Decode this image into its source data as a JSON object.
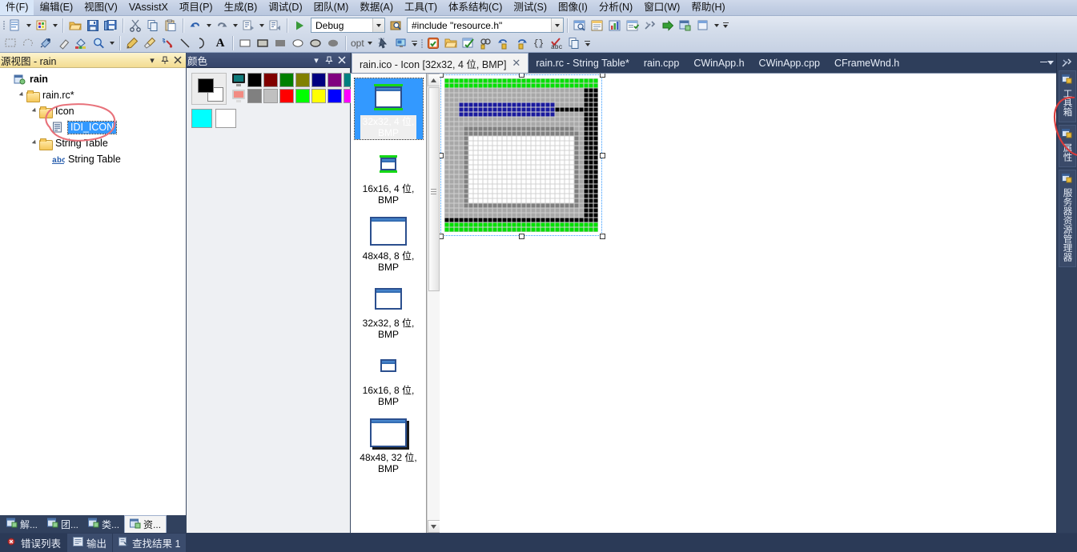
{
  "menu": {
    "items": [
      "件(F)",
      "编辑(E)",
      "视图(V)",
      "VAssistX",
      "项目(P)",
      "生成(B)",
      "调试(D)",
      "团队(M)",
      "数据(A)",
      "工具(T)",
      "体系结构(C)",
      "测试(S)",
      "图像(I)",
      "分析(N)",
      "窗口(W)",
      "帮助(H)"
    ]
  },
  "toolbar": {
    "config_value": "Debug",
    "find_value": "#include \"resource.h\"",
    "opt_label": "opt",
    "icons_row1": [
      "new-item-icon",
      "add-item-icon",
      "open-folder-icon",
      "save-icon",
      "save-all-icon",
      "cut-icon",
      "copy-icon",
      "paste-icon",
      "undo-icon",
      "redo-icon",
      "comment-icon",
      "uncomment-icon",
      "start-debug-icon",
      "find-in-files-icon"
    ],
    "icons_row2": [
      "rect-select-icon",
      "lasso-select-icon",
      "eyedropper-icon",
      "eraser-icon",
      "fill-icon",
      "magnifier-icon",
      "pencil-icon",
      "brush-icon",
      "airbrush-icon",
      "line-icon",
      "curve-icon",
      "text-icon",
      "rect-outline-icon",
      "rect-filled-icon",
      "rect-solid-icon",
      "ellipse-outline-icon",
      "ellipse-filled-icon",
      "ellipse-solid-icon",
      "opt-dropdown",
      "select-cursor-icon",
      "monitor-icon"
    ],
    "icons_right1": [
      "toolbox-icon",
      "properties-window-icon",
      "object-browser-icon",
      "task-list-icon",
      "tools-icon",
      "go-to-icon",
      "class-view-icon",
      "new-window-icon"
    ],
    "icons_right2": [
      "find-symbol-icon",
      "undo-nav-icon",
      "redo-nav-icon",
      "braces-icon",
      "spell-check-icon",
      "copy-doc-icon"
    ]
  },
  "resource_view": {
    "title": "源视图 - rain",
    "dropdown_icon": "chevron-down-icon",
    "pin_icon": "pin-icon",
    "close_icon": "close-icon",
    "tree": [
      {
        "label": "rain",
        "icon": "solution-icon",
        "indent": 0,
        "bold": true,
        "expander": "none"
      },
      {
        "label": "rain.rc*",
        "icon": "folder-icon",
        "indent": 1,
        "bold": false,
        "expander": "open"
      },
      {
        "label": "Icon",
        "icon": "folder-icon",
        "indent": 2,
        "bold": false,
        "expander": "open"
      },
      {
        "label": "IDI_ICON",
        "icon": "resource-icon",
        "indent": 3,
        "bold": false,
        "expander": "none",
        "selected": true
      },
      {
        "label": "String Table",
        "icon": "folder-icon",
        "indent": 2,
        "bold": false,
        "expander": "open"
      },
      {
        "label": "String Table",
        "icon": "abc-icon",
        "indent": 3,
        "bold": false,
        "expander": "none"
      }
    ],
    "bottom_tabs": [
      {
        "label": "解...",
        "icon": "solution-explorer-icon",
        "active": false
      },
      {
        "label": "团...",
        "icon": "team-explorer-icon",
        "active": false
      },
      {
        "label": "类...",
        "icon": "class-view-icon",
        "active": false
      },
      {
        "label": "资...",
        "icon": "resource-view-icon",
        "active": true
      }
    ]
  },
  "colors_panel": {
    "title": "颜色",
    "dropdown_icon": "chevron-down-icon",
    "pin_icon": "pin-icon",
    "close_icon": "close-icon",
    "foreground": "#000000",
    "background": "#ffffff",
    "swatch_row1": [
      "screen",
      "#000000",
      "#800000",
      "#008000",
      "#808000",
      "#000080",
      "#800080",
      "#008080"
    ],
    "swatch_row2": [
      "screen-inverse",
      "#808080",
      "#c0c0c0",
      "#ff0000",
      "#00ff00",
      "#ffff00",
      "#0000ff",
      "#ff00ff"
    ],
    "swatch_row3": [
      "#00ffff",
      "#ffffff"
    ]
  },
  "tabs": [
    {
      "label": "rain.ico - Icon [32x32, 4 位, BMP]",
      "active": true,
      "closable": true
    },
    {
      "label": "rain.rc - String Table*",
      "active": false,
      "closable": false
    },
    {
      "label": "rain.cpp",
      "active": false,
      "closable": false
    },
    {
      "label": "CWinApp.h",
      "active": false,
      "closable": false
    },
    {
      "label": "CWinApp.cpp",
      "active": false,
      "closable": false
    },
    {
      "label": "CFrameWnd.h",
      "active": false,
      "closable": false
    }
  ],
  "icon_list": [
    {
      "label": "32x32, 4 位,\nBMP",
      "size": 34,
      "selected": true,
      "style": "green"
    },
    {
      "label": "16x16, 4 位,\nBMP",
      "size": 20,
      "selected": false,
      "style": "green"
    },
    {
      "label": "48x48, 8 位,\nBMP",
      "size": 46,
      "selected": false,
      "style": "plain"
    },
    {
      "label": "32x32, 8 位,\nBMP",
      "size": 34,
      "selected": false,
      "style": "plain"
    },
    {
      "label": "16x16, 8 位,\nBMP",
      "size": 20,
      "selected": false,
      "style": "plain"
    },
    {
      "label": "48x48, 32 位,\nBMP",
      "size": 46,
      "selected": false,
      "style": "shadow"
    }
  ],
  "canvas": {
    "cell": 6,
    "grid_size": 32,
    "colors": {
      "green": "#00e000",
      "blue": "#1a1a9e",
      "gray": "#a8a8a8",
      "dark_gray": "#808080",
      "white": "#ffffff",
      "black": "#000000",
      "grid_line": "#d0d0d0"
    }
  },
  "right_dock": {
    "tabs": [
      {
        "label": "工具箱",
        "icon": "toolbox-icon"
      },
      {
        "label": "属性",
        "icon": "properties-icon"
      },
      {
        "label": "服务器资源管理器",
        "icon": "server-explorer-icon"
      }
    ],
    "top_icon": "pin-tools-icon"
  },
  "status_bar": {
    "items": [
      {
        "label": "错误列表",
        "icon": "error-list-icon",
        "active": false
      },
      {
        "label": "输出",
        "icon": "output-icon",
        "active": true
      },
      {
        "label": "查找结果 1",
        "icon": "find-results-icon",
        "active": true
      }
    ]
  },
  "annotations": {
    "tree_circle_color": "#e8717a",
    "dock_circle_color": "#d93b3b"
  }
}
